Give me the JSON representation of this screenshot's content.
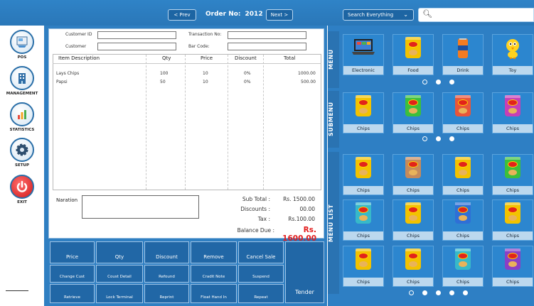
{
  "topbar": {
    "prev_label": "< Prev",
    "order_label": "Order No:",
    "order_number": "2012",
    "next_label": "Next >",
    "search_select": "Search Everything",
    "search_value": ""
  },
  "sidebar": {
    "items": [
      {
        "label": "POS",
        "icon": "pos-icon"
      },
      {
        "label": "MANAGEMENT",
        "icon": "building-icon"
      },
      {
        "label": "STATISTICS",
        "icon": "bar-chart-icon"
      },
      {
        "label": "SETUP",
        "icon": "gear-icon"
      },
      {
        "label": "EXIT",
        "icon": "power-icon"
      }
    ]
  },
  "form": {
    "customer_id_label": "Customer ID",
    "customer_label": "Customer",
    "transaction_label": "Transaction No:",
    "barcode_label": "Bar Code:",
    "customer_id_value": "",
    "customer_value": "",
    "transaction_value": "",
    "barcode_value": ""
  },
  "table": {
    "headers": [
      "Item Description",
      "Qty",
      "Price",
      "Discount",
      "Total"
    ],
    "rows": [
      [
        "Lays Chips",
        "100",
        "10",
        "0%",
        "1000.00"
      ],
      [
        "Papsi",
        "50",
        "10",
        "0%",
        "500.00"
      ]
    ]
  },
  "totals": {
    "naration_label": "Naration",
    "subtotal_label": "Sub Total :",
    "subtotal_value": "Rs. 1500.00",
    "discounts_label": "Discounts :",
    "discounts_value": "00.00",
    "tax_label": "Tax :",
    "tax_value": "Rs.100.00",
    "balance_label": "Balance Due :",
    "balance_value": "Rs. 1600.00"
  },
  "buttons": {
    "price": "Price",
    "qty": "Qty",
    "discount": "Discount",
    "remove": "Remove",
    "cancel_sale": "Cancel Sale",
    "change_cust": "Change Cust",
    "coust_detail": "Coust Detail",
    "refound": "Refound",
    "credit_note": "Cradit Note",
    "suspend": "Suspend",
    "retrieve": "Retrieve",
    "lock_terminal": "Lock Terminal",
    "reprint": "Reprint",
    "float_hand_in": "Float Hand In",
    "repeat": "Repeat",
    "tender": "Tender"
  },
  "right": {
    "menu_tag": "MENU",
    "submenu_tag": "SUBMENU",
    "menulist_tag": "MENU LIST",
    "menu": [
      "Electronic",
      "Food",
      "Drink",
      "Toy"
    ],
    "submenu": [
      "Chips",
      "Chips",
      "Chips",
      "Chips"
    ],
    "menu_list": [
      "Chips",
      "Chips",
      "Chips",
      "Chips",
      "Chips",
      "Chips",
      "Chips",
      "Chips",
      "Chips",
      "Chips",
      "Chips",
      "Chips"
    ]
  },
  "colors": {
    "accent": "#2f7fc2",
    "balance": "#e21c1c",
    "exit": "#d11a1a"
  }
}
